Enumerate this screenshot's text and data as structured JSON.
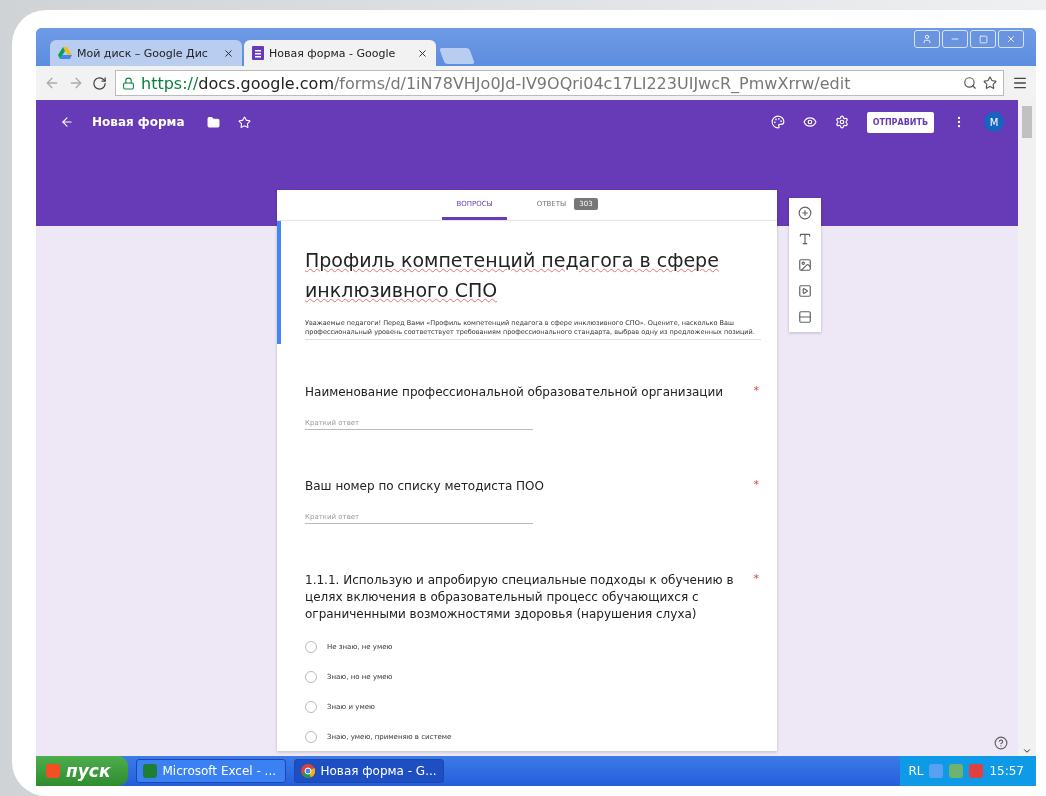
{
  "browser": {
    "tabs": [
      {
        "title": "Мой диск – Google Дис",
        "selected": false
      },
      {
        "title": "Новая форма - Google",
        "selected": true
      }
    ],
    "address": {
      "scheme": "https://",
      "host": "docs.google.com",
      "path": "/forms/d/1iN78VHJo0Jd-IV9OQri04c17LI223UIJwcR_PmwXrrw/edit"
    }
  },
  "header": {
    "title": "Новая форма",
    "send_button": "ОТПРАВИТЬ",
    "avatar": "M"
  },
  "form_tabs": [
    {
      "label": "ВОПРОСЫ",
      "selected": true
    },
    {
      "label": "ОТВЕТЫ",
      "badge": "303",
      "selected": false
    }
  ],
  "form": {
    "title": "Профиль компетенций педагога в сфере инклюзивного СПО",
    "description": "Уважаемые педагоги! Перед Вами «Профиль компетенций педагога в сфере инклюзивного СПО». Оцените, насколько Ваш профессиональный уровень соответствует требованиям профессионального стандарта, выбрав одну из предложенных позиций.",
    "selected": true
  },
  "questions": [
    {
      "kind": "short",
      "text": "Наименование профессиональной образовательной организации",
      "required_mark": "*",
      "placeholder": "Краткий ответ"
    },
    {
      "kind": "short",
      "text": "Ваш номер по списку методиста ПОО",
      "required_mark": "*",
      "placeholder": "Краткий ответ"
    },
    {
      "kind": "choice",
      "text": "1.1.1. Использую и апробирую специальные подходы к обучению в целях включения в образовательный процесс обучающихся с ограниченными возможностями здоровья (нарушения слуха)",
      "required_mark": "*",
      "options": [
        {
          "label": "Не знаю, не умею",
          "selected": false
        },
        {
          "label": "Знаю, но не умею",
          "selected": false
        },
        {
          "label": "Знаю и умею",
          "selected": false
        },
        {
          "label": "Знаю, умею, применяю в системе",
          "selected": false
        }
      ]
    }
  ],
  "taskbar": {
    "start": "пуск",
    "items": [
      {
        "label": "Microsoft Excel - ...",
        "selected": false
      },
      {
        "label": "Новая форма - G...",
        "selected": true
      }
    ],
    "lang": "RL",
    "time": "15:57"
  }
}
